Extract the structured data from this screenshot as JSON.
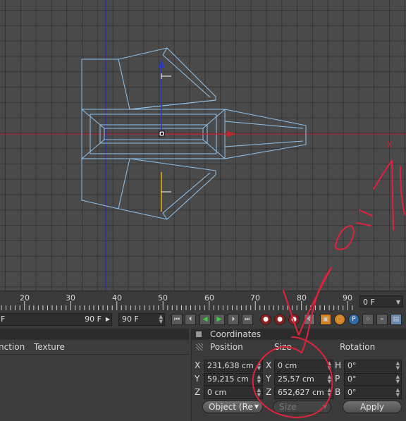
{
  "ruler": {
    "ticks": [
      "20",
      "30",
      "40",
      "50",
      "60",
      "70",
      "80",
      "90"
    ],
    "current_frame": "0 F"
  },
  "transport": {
    "range_end": "90 F",
    "max_frame": "90 F"
  },
  "left_panel": {
    "tab_function": "nction",
    "tab_texture": "Texture"
  },
  "coordinates": {
    "title": "Coordinates",
    "col_position": "Position",
    "col_size": "Size",
    "col_rotation": "Rotation",
    "axes": [
      "X",
      "Y",
      "Z"
    ],
    "rot_axes": [
      "H",
      "P",
      "B"
    ],
    "position": [
      "231,638 cm",
      "59,215 cm",
      "0 cm"
    ],
    "size": [
      "0 cm",
      "25,57 cm",
      "652,627 cm"
    ],
    "rotation": [
      "0°",
      "0°",
      "0°"
    ],
    "mode_dropdown": "Object (Re",
    "size_dropdown": "Size",
    "apply_label": "Apply"
  },
  "viewport": {
    "axis_x_label": "X"
  },
  "handwriting": "여기",
  "colors": {
    "wireframe": "#8fc4ee",
    "axis_red": "#c0272d",
    "axis_blue": "#1e22c8",
    "annotation": "#e0233a"
  }
}
